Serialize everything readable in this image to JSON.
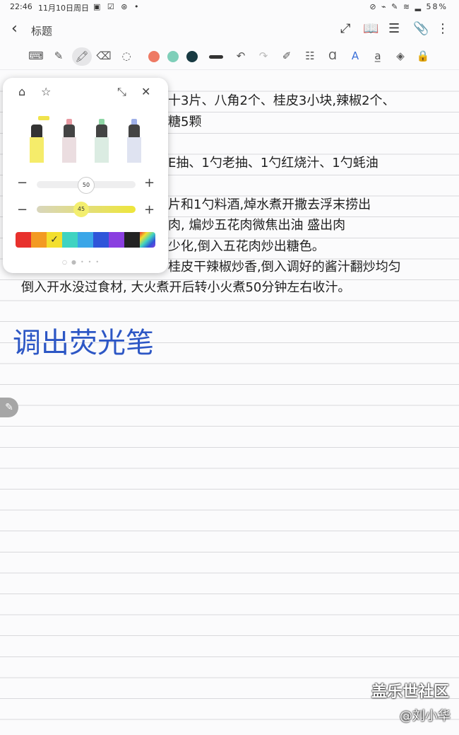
{
  "status": {
    "time": "22:46",
    "date": "11月10日周日",
    "icons": "▣ ☑ ⊛ •",
    "right": "⊘ ⌁ ✎ ≋ ▂ 58%"
  },
  "header": {
    "title": "标题"
  },
  "toolbar": {
    "tools": [
      "keyboard-icon",
      "pen-icon",
      "highlighter-icon",
      "eraser-icon",
      "lasso-icon"
    ],
    "colors": [
      "#ee7a64",
      "#7fcfb9",
      "#183a42"
    ],
    "right_tools": [
      "stroke-width-icon",
      "undo-icon",
      "redo-icon",
      "shape-icon",
      "align-icon",
      "text-style-icon",
      "text-effect-icon",
      "text-box-icon",
      "fill-icon",
      "lock-icon"
    ]
  },
  "note": {
    "lines": [
      "十3片、八角2个、桂皮3小块,辣椒2个、",
      "糖5颗",
      "E抽、1勺老抽、1勺红烧汁、1勺蚝油",
      "片和1勺料酒,焯水煮开撒去浮末捞出",
      "肉, 煸炒五花肉微焦出油 盛出肉",
      "少化,倒入五花肉炒出糖色。",
      "桂皮干辣椒炒香,倒入调好的酱汁翻炒均匀",
      "倒入开水没过食材, 大火煮开后转小火煮50分钟左右收汁。"
    ],
    "big_title": "调出荧光笔"
  },
  "popup": {
    "size_value": "50",
    "opacity_value": "45",
    "size_level": 0.5,
    "opacity_level": 0.45,
    "pens": [
      {
        "name": "yellow-highlighter",
        "color": "#f0e34c"
      },
      {
        "name": "pink-highlighter",
        "color": "#e89aa3"
      },
      {
        "name": "green-highlighter",
        "color": "#8fd6a6"
      },
      {
        "name": "blue-highlighter",
        "color": "#9fb0e8"
      }
    ],
    "palette": [
      "#e8312d",
      "#f39a22",
      "#f3df2e",
      "#3fd3c1",
      "#3aa6e8",
      "#2f55d9",
      "#8a3fe0",
      "#232323",
      "multi"
    ],
    "selected_color_index": 2
  },
  "watermark": {
    "line1": "盖乐世社区",
    "line2": "@刘小华"
  }
}
